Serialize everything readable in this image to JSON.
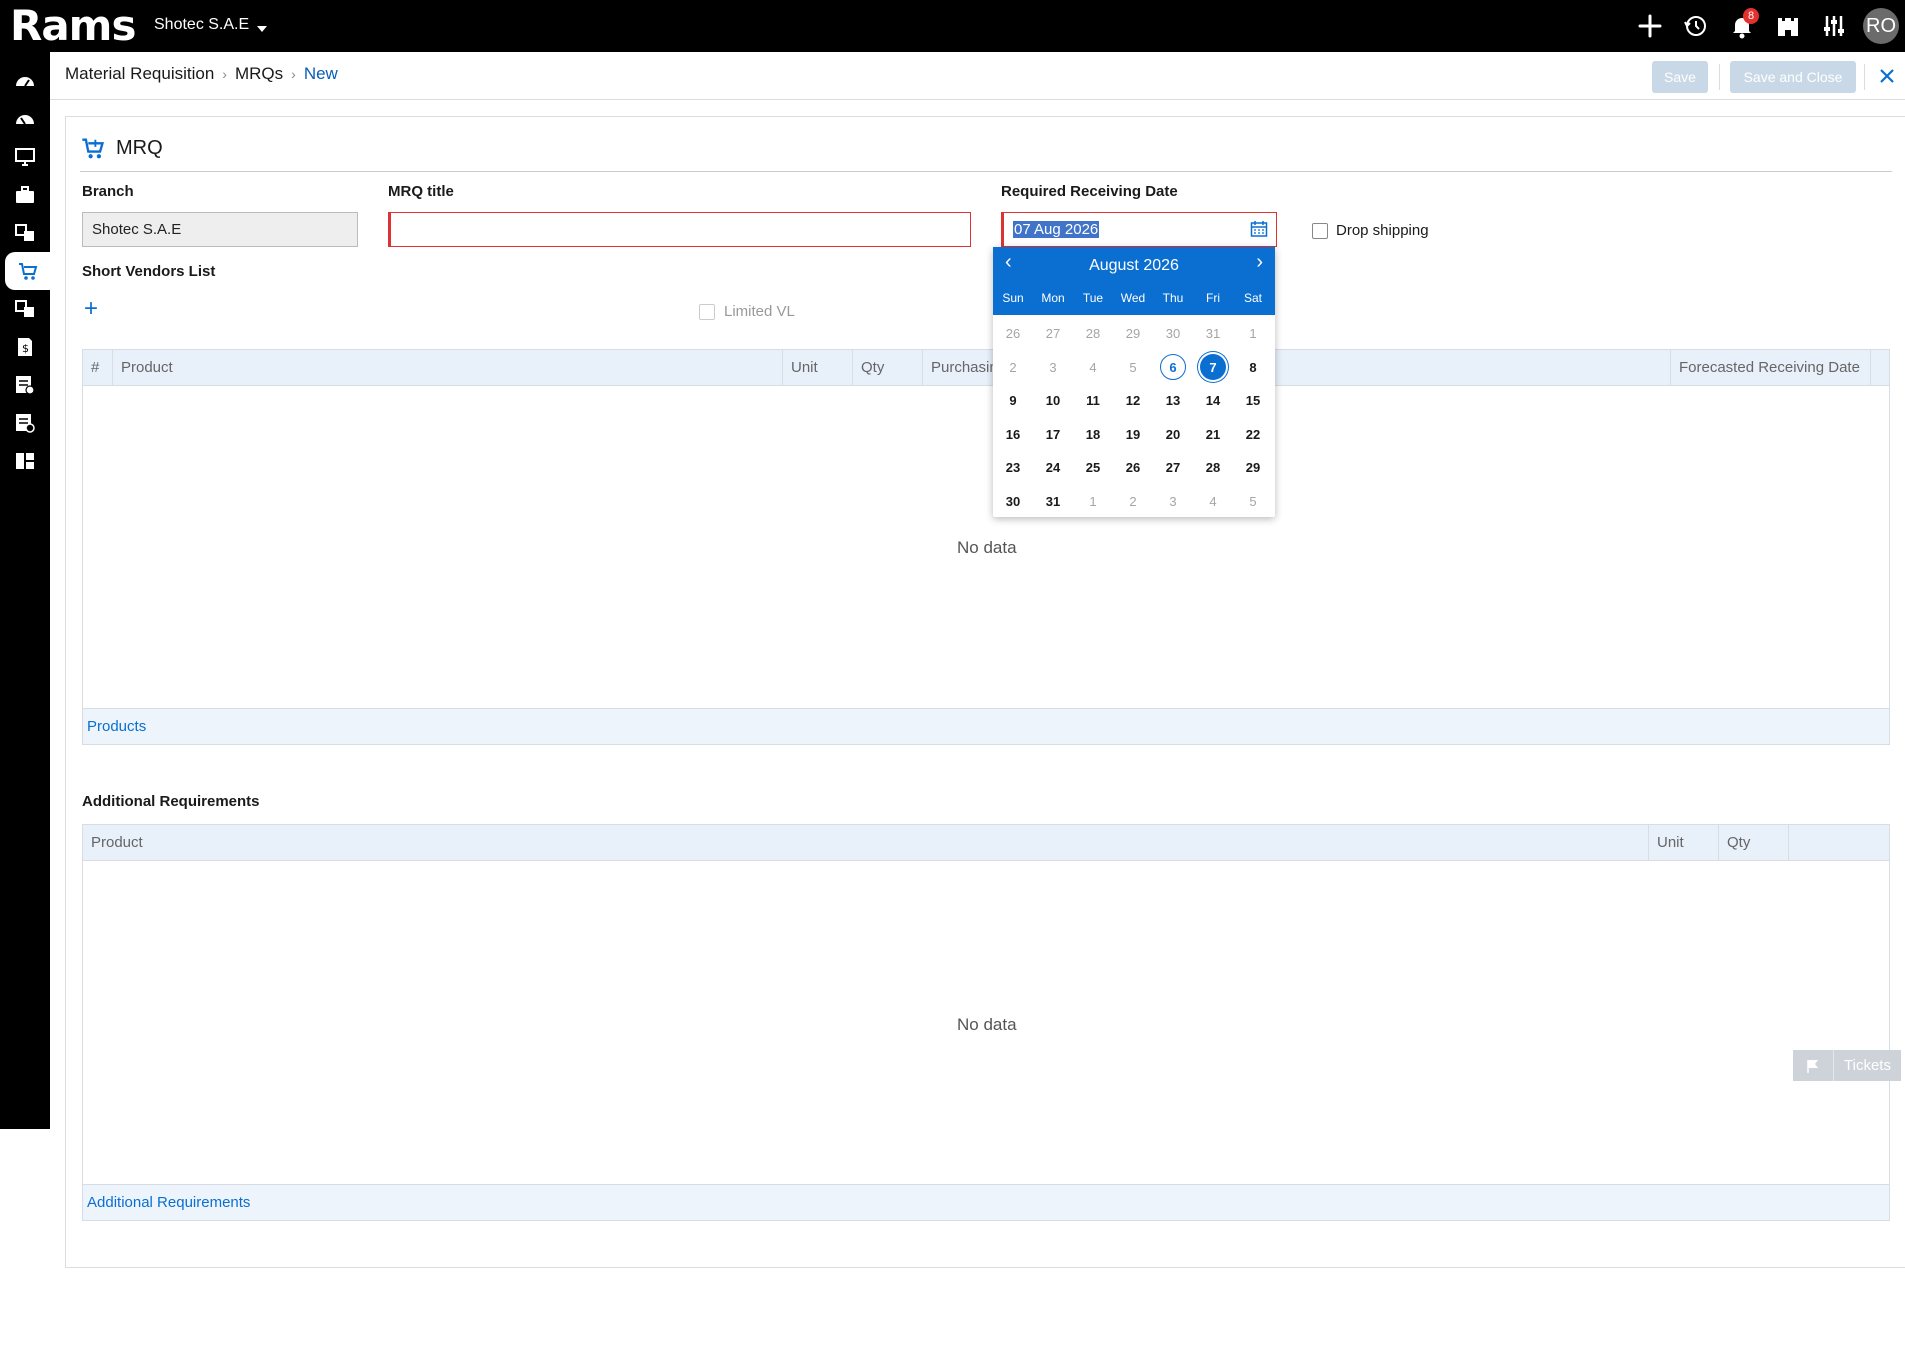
{
  "topbar": {
    "logo": "Rams",
    "company": "Shotec S.A.E",
    "notification_count": "8",
    "avatar_initials": "RO",
    "icons": [
      "add-icon",
      "history-icon",
      "bell-icon",
      "castle-icon",
      "sliders-icon"
    ]
  },
  "sidebar": {
    "items": [
      "dashboard-icon",
      "dashboard-icon",
      "monitor-icon",
      "briefcase-icon",
      "transfer-icon",
      "cart-icon",
      "transfer-icon",
      "invoice-icon",
      "checklist-icon",
      "document-settings-icon",
      "grid-icon"
    ],
    "active_index": 5
  },
  "breadcrumb": {
    "module": "Material Requisition",
    "list": "MRQs",
    "current": "New"
  },
  "actions": {
    "save_label": "Save",
    "save_close_label": "Save and Close"
  },
  "form": {
    "title": "MRQ",
    "branch_label": "Branch",
    "branch_value": "Shotec S.A.E",
    "mrq_title_label": "MRQ title",
    "mrq_title_value": "",
    "date_label": "Required Receiving Date",
    "date_value": "07 Aug 2026",
    "drop_shipping_label": "Drop shipping",
    "short_vendors_label": "Short Vendors List",
    "limited_vl_label": "Limited VL"
  },
  "products_grid": {
    "columns": [
      "#",
      "Product",
      "Unit",
      "Qty",
      "Purchasing",
      "Forecasted Receiving Date"
    ],
    "empty_text": "No data",
    "footer_link": "Products"
  },
  "additional_requirements": {
    "title": "Additional Requirements",
    "columns": [
      "Product",
      "Unit",
      "Qty"
    ],
    "empty_text": "No data",
    "footer_link": "Additional Requirements"
  },
  "calendar": {
    "month_label": "August 2026",
    "weekdays": [
      "Sun",
      "Mon",
      "Tue",
      "Wed",
      "Thu",
      "Fri",
      "Sat"
    ],
    "weeks": [
      [
        "26",
        "27",
        "28",
        "29",
        "30",
        "31",
        "1"
      ],
      [
        "2",
        "3",
        "4",
        "5",
        "6",
        "7",
        "8"
      ],
      [
        "9",
        "10",
        "11",
        "12",
        "13",
        "14",
        "15"
      ],
      [
        "16",
        "17",
        "18",
        "19",
        "20",
        "21",
        "22"
      ],
      [
        "23",
        "24",
        "25",
        "26",
        "27",
        "28",
        "29"
      ],
      [
        "30",
        "31",
        "1",
        "2",
        "3",
        "4",
        "5"
      ]
    ],
    "muted": [
      [
        0,
        0
      ],
      [
        0,
        1
      ],
      [
        0,
        2
      ],
      [
        0,
        3
      ],
      [
        0,
        4
      ],
      [
        0,
        5
      ],
      [
        0,
        6
      ],
      [
        1,
        0
      ],
      [
        1,
        1
      ],
      [
        1,
        2
      ],
      [
        1,
        3
      ],
      [
        5,
        2
      ],
      [
        5,
        3
      ],
      [
        5,
        4
      ],
      [
        5,
        5
      ],
      [
        5,
        6
      ]
    ],
    "today": [
      1,
      4
    ],
    "selected": [
      1,
      5
    ]
  },
  "tickets_label": "Tickets",
  "colors": {
    "accent": "#0a6fd1",
    "topbar": "#000000",
    "required_border": "#dd3333",
    "badge": "#e3322e"
  }
}
